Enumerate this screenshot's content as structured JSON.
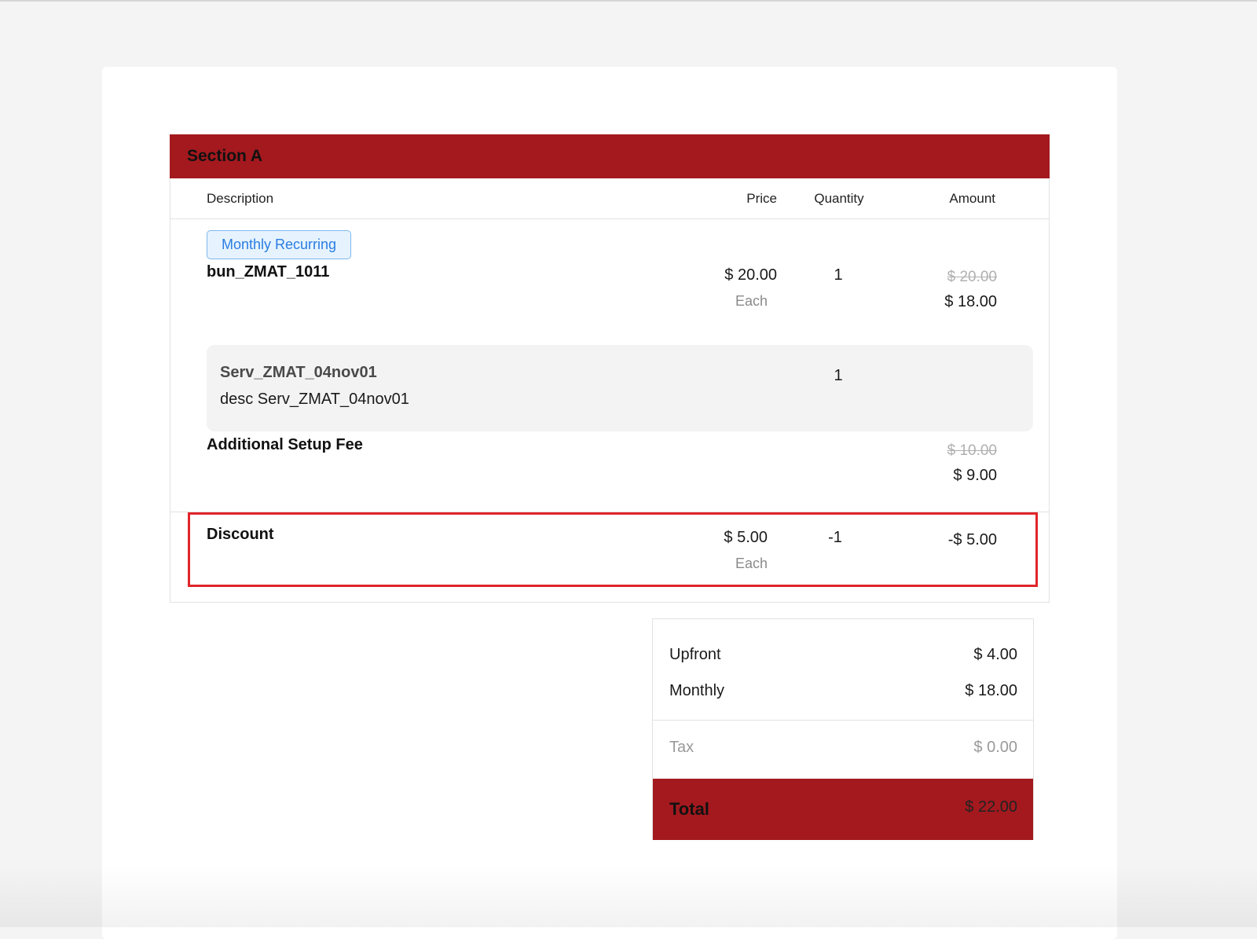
{
  "section": {
    "title": "Section A"
  },
  "columns": {
    "description": "Description",
    "price": "Price",
    "quantity": "Quantity",
    "amount": "Amount"
  },
  "badge": "Monthly Recurring",
  "product": {
    "name": "bun_ZMAT_1011",
    "price": "$ 20.00",
    "price_unit": "Each",
    "quantity": "1",
    "amount_original": "$ 20.00",
    "amount": "$ 18.00"
  },
  "sub_item": {
    "name": "Serv_ZMAT_04nov01",
    "description": "desc Serv_ZMAT_04nov01",
    "quantity": "1"
  },
  "setup_fee": {
    "label": "Additional Setup Fee",
    "amount_original": "$ 10.00",
    "amount": "$ 9.00"
  },
  "discount": {
    "label": "Discount",
    "price": "$ 5.00",
    "price_unit": "Each",
    "quantity": "-1",
    "amount": "-$ 5.00"
  },
  "summary": {
    "upfront_label": "Upfront",
    "upfront_value": "$ 4.00",
    "monthly_label": "Monthly",
    "monthly_value": "$ 18.00",
    "tax_label": "Tax",
    "tax_value": "$ 0.00",
    "total_label": "Total",
    "total_value": "$ 22.00"
  },
  "colors": {
    "header_red": "#a3191e",
    "highlight_red": "#e0252b",
    "badge_blue": "#2a7de1",
    "badge_bg": "#e6f3ff"
  }
}
